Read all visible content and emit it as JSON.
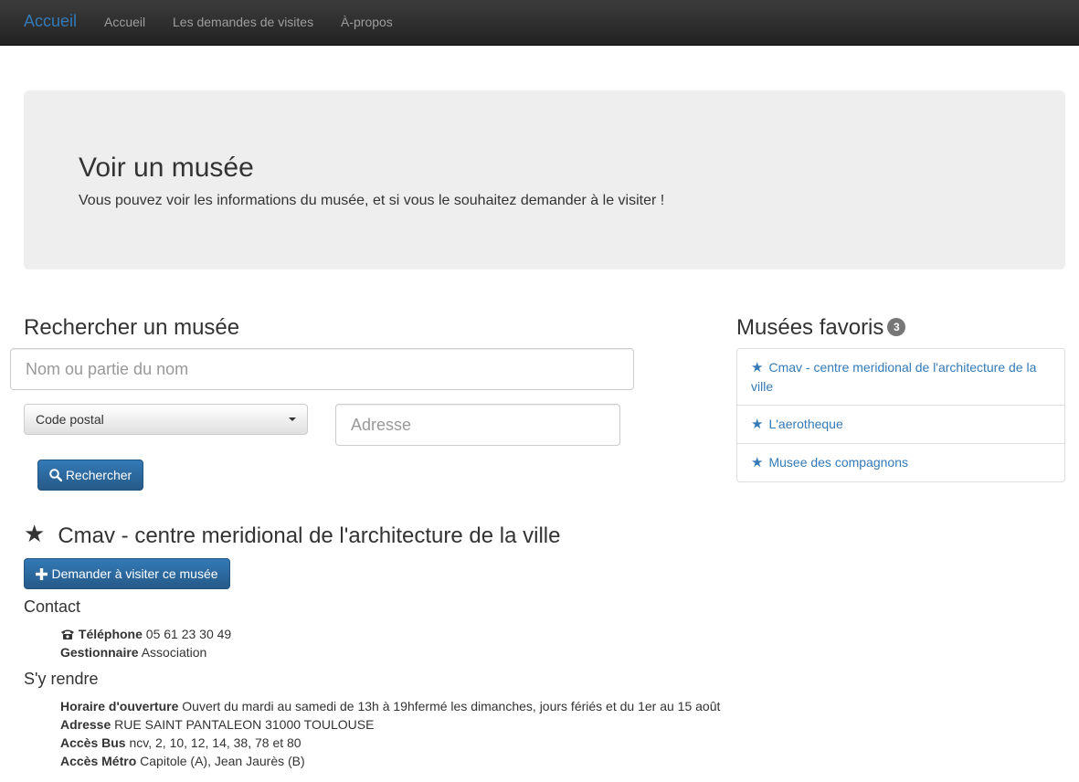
{
  "nav": {
    "brand": "Accueil",
    "links": [
      "Accueil",
      "Les demandes de visites",
      "À-propos"
    ]
  },
  "jumbotron": {
    "title": "Voir un musée",
    "text": "Vous pouvez voir les informations du musée, et si vous le souhaitez demander à le visiter !"
  },
  "search": {
    "heading": "Rechercher un musée",
    "name_placeholder": "Nom ou partie du nom",
    "postal_select": "Code postal",
    "address_placeholder": "Adresse",
    "button_label": "Rechercher"
  },
  "favorites": {
    "heading": "Musées favoris",
    "count": "3",
    "items": [
      "Cmav - centre meridional de l'architecture de la ville",
      "L'aerotheque",
      "Musee des compagnons"
    ]
  },
  "museum": {
    "star": "★",
    "name": "Cmav - centre meridional de l'architecture de la ville",
    "visit_button": "Demander à visiter ce musée",
    "contact_heading": "Contact",
    "phone_label": "Téléphone",
    "phone_value": "05 61 23 30 49",
    "manager_label": "Gestionnaire",
    "manager_value": "Association",
    "access_heading": "S'y rendre",
    "hours_label": "Horaire d'ouverture",
    "hours_value": "Ouvert du mardi au samedi de 13h à 19hfermé les dimanches, jours fériés et du 1er au 15 août",
    "address_label": "Adresse",
    "address_value": "RUE SAINT PANTALEON 31000 TOULOUSE",
    "bus_label": "Accès Bus",
    "bus_value": "ncv, 2, 10, 12, 14, 38, 78 et 80",
    "metro_label": "Accès Métro",
    "metro_value": "Capitole (A), Jean Jaurès (B)"
  },
  "colors": {
    "primary": "#337ab7",
    "navbar": "#222222",
    "jumbotron": "#eeeeee",
    "badge": "#777777"
  },
  "icons": [
    "search-icon",
    "plus-icon",
    "star-icon",
    "phone-icon",
    "chevron-down-icon"
  ]
}
